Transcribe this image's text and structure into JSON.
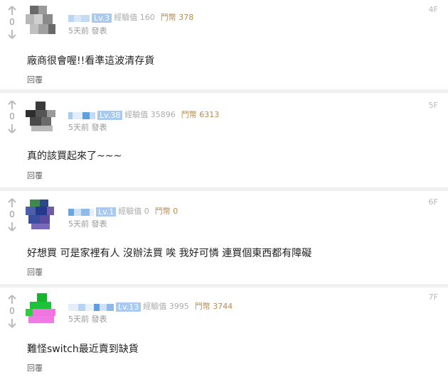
{
  "posts": [
    {
      "floor": "4F",
      "level": "Lv.3",
      "exp": "經驗值 160",
      "coins": "鬥幣 378",
      "time_action": "5天前 發表",
      "content": "廠商很會喔!!看準這波清存貨",
      "votes": "0",
      "reply_label": "回覆"
    },
    {
      "floor": "5F",
      "level": "Lv.38",
      "exp": "經驗值 35896",
      "coins": "鬥幣 6313",
      "time_action": "5天前 發表",
      "content": "真的該買起來了~~~",
      "votes": "0",
      "reply_label": "回覆"
    },
    {
      "floor": "6F",
      "level": "Lv.1",
      "exp": "經驗值 0",
      "coins": "鬥幣 0",
      "time_action": "5天前 發表",
      "content": "好想買 可是家裡有人 沒辦法買 唉 我好可憐 連買個東西都有障礙",
      "votes": "0",
      "reply_label": "回覆"
    },
    {
      "floor": "7F",
      "level": "Lv.13",
      "exp": "經驗值 3995",
      "coins": "鬥幣 3744",
      "time_action": "5天前 發表",
      "content": "難怪switch最近賣到缺貨",
      "votes": "0",
      "reply_label": "回覆"
    }
  ],
  "icons": {
    "up": "arrow-up-icon",
    "down": "arrow-down-icon"
  },
  "colors": {
    "level_badge": "#a9c9ef",
    "coin_text": "#b38b52",
    "separator": "#f0f0f0"
  }
}
